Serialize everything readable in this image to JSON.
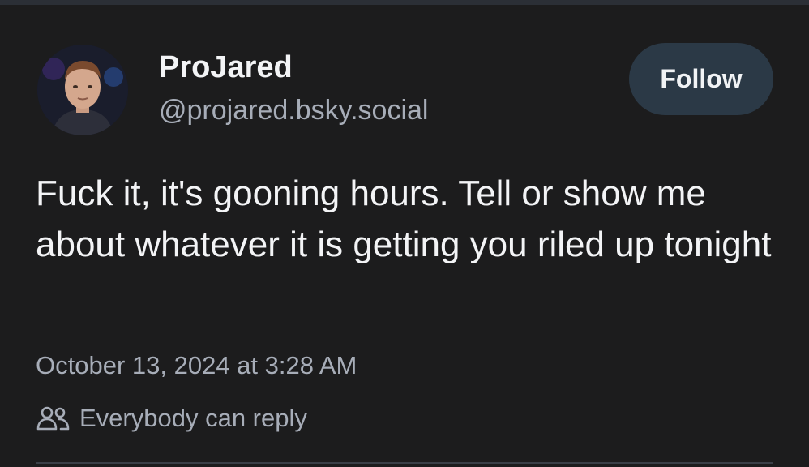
{
  "post": {
    "author": {
      "display_name": "ProJared",
      "handle": "@projared.bsky.social",
      "avatar_icon": "profile-photo"
    },
    "follow_label": "Follow",
    "text": "Fuck it, it's gooning hours. Tell or show me about whatever it is getting you riled up tonight",
    "timestamp": "October 13, 2024 at 3:28 AM",
    "reply_setting": {
      "icon": "people-icon",
      "label": "Everybody can reply"
    }
  },
  "colors": {
    "background": "#1c1c1d",
    "primary_text": "#f3f4f6",
    "secondary_text": "#a7adb8",
    "follow_button_bg": "#2b3946"
  }
}
